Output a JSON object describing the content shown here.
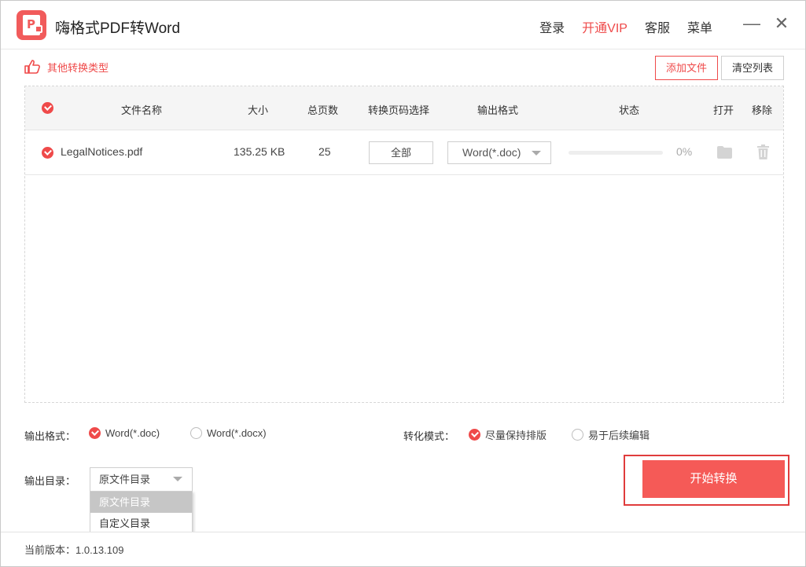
{
  "app": {
    "logo_letter": "P",
    "title": "嗨格式PDF转Word",
    "menu": {
      "login": "登录",
      "vip": "开通VIP",
      "service": "客服",
      "menu": "菜单"
    },
    "minimize_glyph": "—",
    "close_glyph": "✕"
  },
  "toolbar": {
    "other_types": "其他转换类型",
    "add_file": "添加文件",
    "clear_list": "清空列表"
  },
  "table": {
    "headers": {
      "name": "文件名称",
      "size": "大小",
      "pages": "总页数",
      "page_select": "转换页码选择",
      "output_format": "输出格式",
      "status": "状态",
      "open": "打开",
      "remove": "移除"
    },
    "rows": [
      {
        "name": "LegalNotices.pdf",
        "size": "135.25 KB",
        "pages": "25",
        "page_select": "全部",
        "format": "Word(*.doc)",
        "progress_text": "0%",
        "progress": 0
      }
    ]
  },
  "options": {
    "format_label": "输出格式：",
    "format_doc": "Word(*.doc)",
    "format_docx": "Word(*.docx)",
    "format_selected": "doc",
    "mode_label": "转化模式：",
    "mode_keep": "尽量保持排版",
    "mode_edit": "易于后续编辑",
    "mode_selected": "keep",
    "dir_label": "输出目录：",
    "dir_value": "原文件目录",
    "dir_options": [
      "原文件目录",
      "自定义目录"
    ]
  },
  "actions": {
    "start": "开始转换"
  },
  "footer": {
    "version": "当前版本：1.0.13.109"
  },
  "colors": {
    "accent": "#ef4a4a",
    "start": "#f55a57",
    "highlight": "#e03c3c"
  },
  "icons": {
    "logo": "pdf-logo-icon",
    "thumb": "thumb-icon",
    "folder": "folder-icon",
    "trash": "trash-icon",
    "check": "check-icon",
    "caret": "chevron-down-icon"
  }
}
